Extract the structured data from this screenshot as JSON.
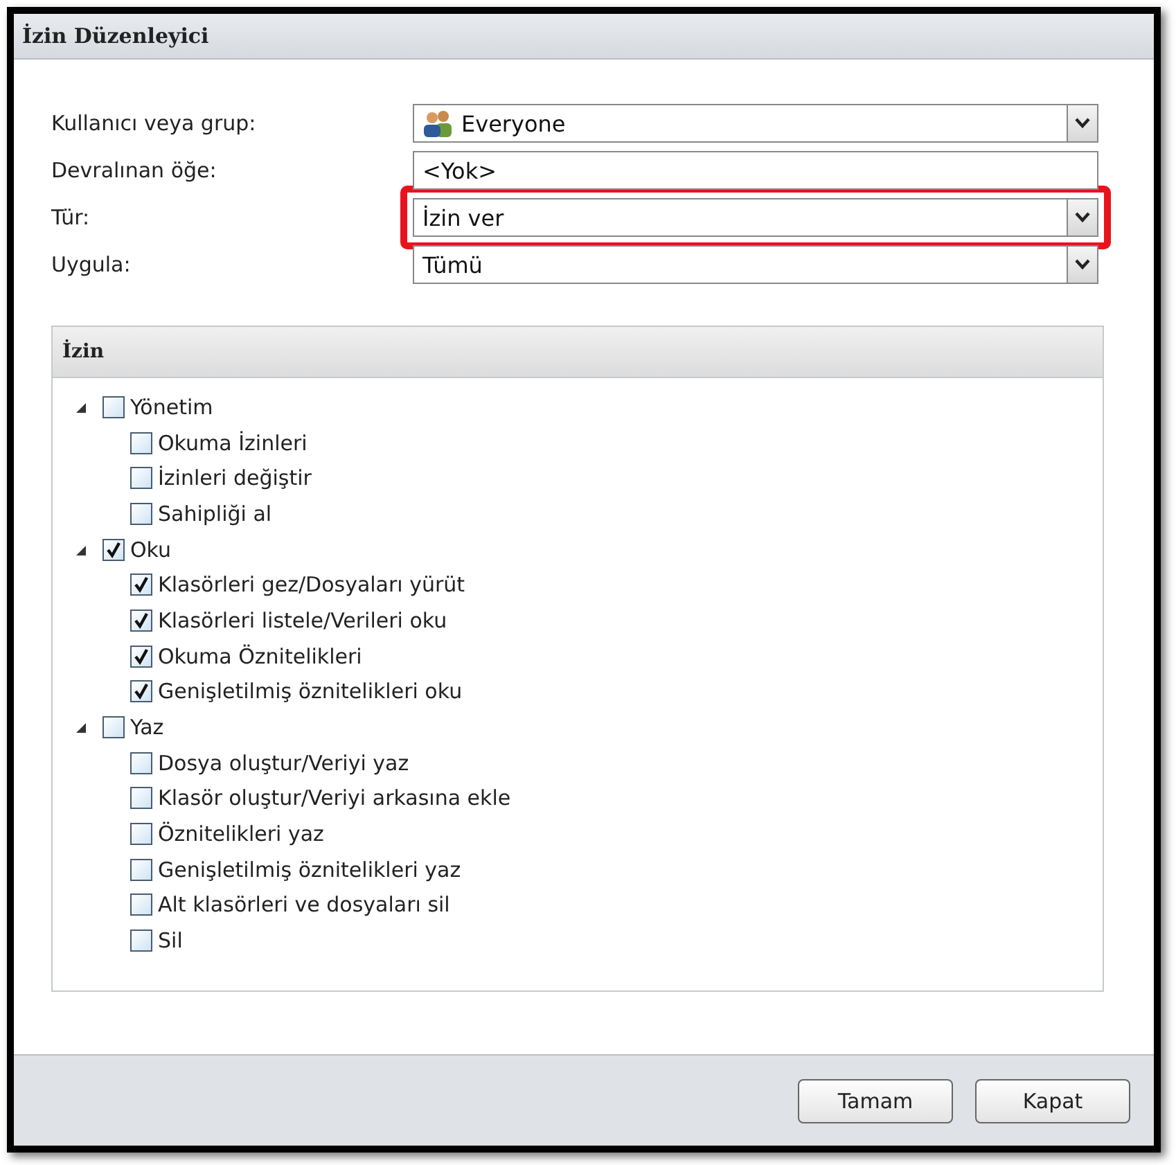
{
  "window": {
    "title": "İzin Düzenleyici"
  },
  "form": [
    {
      "label": "Kullanıcı veya grup:",
      "kind": "group",
      "value": "Everyone",
      "highlighted": false
    },
    {
      "label": "Devralınan öğe:",
      "kind": "text",
      "value": "<Yok>",
      "highlighted": false
    },
    {
      "label": "Tür:",
      "kind": "select",
      "value": "İzin ver",
      "highlighted": true
    },
    {
      "label": "Uygula:",
      "kind": "select",
      "value": "Tümü",
      "highlighted": false
    }
  ],
  "permissions": {
    "title": "İzin",
    "tree": [
      {
        "label": "Yönetim",
        "checked": false,
        "expanded": true,
        "children": [
          {
            "label": "Okuma İzinleri",
            "checked": false
          },
          {
            "label": "İzinleri değiştir",
            "checked": false
          },
          {
            "label": "Sahipliği al",
            "checked": false
          }
        ]
      },
      {
        "label": "Oku",
        "checked": true,
        "expanded": true,
        "children": [
          {
            "label": "Klasörleri gez/Dosyaları yürüt",
            "checked": true
          },
          {
            "label": "Klasörleri listele/Verileri oku",
            "checked": true
          },
          {
            "label": "Okuma Öznitelikleri",
            "checked": true
          },
          {
            "label": "Genişletilmiş öznitelikleri oku",
            "checked": true
          }
        ]
      },
      {
        "label": "Yaz",
        "checked": false,
        "expanded": true,
        "children": [
          {
            "label": "Dosya oluştur/Veriyi yaz",
            "checked": false
          },
          {
            "label": "Klasör oluştur/Veriyi arkasına ekle",
            "checked": false
          },
          {
            "label": "Öznitelikleri yaz",
            "checked": false
          },
          {
            "label": "Genişletilmiş öznitelikleri yaz",
            "checked": false
          },
          {
            "label": "Alt klasörleri ve dosyaları sil",
            "checked": false
          },
          {
            "label": "Sil",
            "checked": false
          }
        ]
      }
    ]
  },
  "buttons": [
    "Tamam",
    "Kapat"
  ]
}
